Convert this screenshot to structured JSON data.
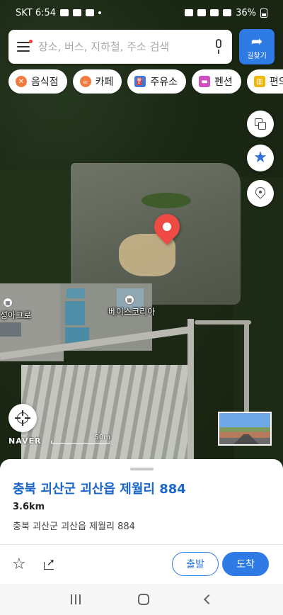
{
  "status_bar": {
    "carrier_time": "SKT 6:54",
    "battery": "36%"
  },
  "search": {
    "placeholder": "장소, 버스, 지하철, 주소 검색"
  },
  "directions_button": {
    "label": "길찾기"
  },
  "category_chips": [
    {
      "label": "음식점",
      "icon": "restaurant-icon",
      "color": "#f07b3f"
    },
    {
      "label": "카페",
      "icon": "cafe-icon",
      "color": "#f07b3f"
    },
    {
      "label": "주유소",
      "icon": "gas-station-icon",
      "color": "#3b7be0"
    },
    {
      "label": "펜션",
      "icon": "bed-icon",
      "color": "#d04fc0"
    },
    {
      "label": "편의점",
      "icon": "store-icon",
      "color": "#f2b705"
    }
  ],
  "map": {
    "labels": {
      "poi_business": "베이스코리아",
      "poi_left": "성아그로"
    },
    "brand": "NAVER",
    "scale_label": "50m"
  },
  "place": {
    "title": "충북 괴산군 괴산읍 제월리 884",
    "distance": "3.6km",
    "address": "충북 괴산군 괴산읍 제월리 884"
  },
  "actions": {
    "start_label": "출발",
    "arrive_label": "도착"
  },
  "colors": {
    "accent": "#2f7be5",
    "title_blue": "#1b66c9",
    "marker_red": "#ef4a44"
  }
}
